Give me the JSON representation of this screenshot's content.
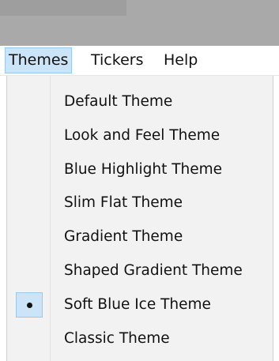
{
  "menubar": {
    "items": [
      {
        "label": "Themes",
        "open": true
      },
      {
        "label": "Tickers",
        "open": false
      },
      {
        "label": "Help",
        "open": false
      }
    ]
  },
  "themes_menu": {
    "items": [
      {
        "label": "Default Theme",
        "selected": false
      },
      {
        "label": "Look and Feel Theme",
        "selected": false
      },
      {
        "label": "Blue Highlight Theme",
        "selected": false
      },
      {
        "label": "Slim Flat Theme",
        "selected": false
      },
      {
        "label": "Gradient Theme",
        "selected": false
      },
      {
        "label": "Shaped Gradient Theme",
        "selected": false
      },
      {
        "label": "Soft Blue Ice Theme",
        "selected": true
      },
      {
        "label": "Classic Theme",
        "selected": false
      }
    ]
  },
  "colors": {
    "menu_highlight": "#cce4f7",
    "menu_highlight_border": "#99c9ef",
    "popup_background": "#f2f2f2",
    "title_strip": "#a9a9a9"
  },
  "icons": {
    "selected_indicator": "radio-dot-icon"
  }
}
